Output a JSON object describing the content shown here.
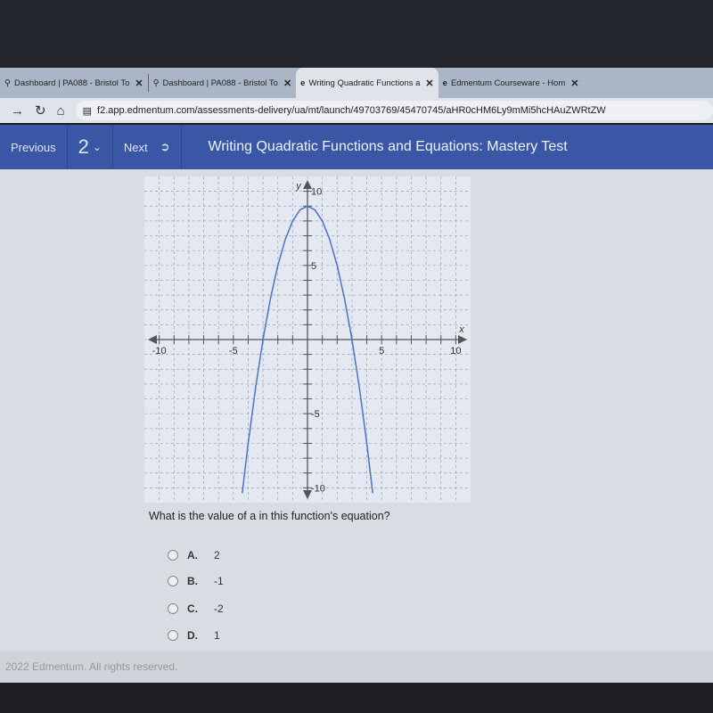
{
  "browser": {
    "tabs": [
      {
        "label": "Dashboard | PA088 - Bristol To",
        "icon": "location-pin-icon",
        "active": false
      },
      {
        "label": "Dashboard | PA088 - Bristol To",
        "icon": "location-pin-icon",
        "active": false
      },
      {
        "label": "Writing Quadratic Functions a",
        "icon": "edmentum-icon",
        "active": true
      },
      {
        "label": "Edmentum Courseware - Hom",
        "icon": "edmentum-icon",
        "active": false
      }
    ],
    "close_glyph": "✕",
    "url": "f2.app.edmentum.com/assessments-delivery/ua/mt/launch/49703769/45470745/aHR0cHM6Ly9mMi5hcHAuZWRtZW"
  },
  "nav": {
    "previous": "Previous",
    "question_number": "2",
    "next": "Next",
    "title": "Writing Quadratic Functions and Equations: Mastery Test"
  },
  "chart_data": {
    "type": "line",
    "xlabel": "x",
    "ylabel": "y",
    "xlim": [
      -10,
      10
    ],
    "ylim": [
      -10,
      10
    ],
    "grid": true,
    "x_tick_labels": [
      "-10",
      "-5",
      "5",
      "10"
    ],
    "y_tick_labels": [
      "10",
      "5",
      "-5",
      "-10"
    ],
    "x": [
      -4.4,
      -4,
      -3.5,
      -3,
      -2.5,
      -2,
      -1.5,
      -1,
      -0.5,
      0,
      0.5,
      1,
      1.5,
      2,
      2.5,
      3,
      3.5,
      4,
      4.4
    ],
    "y": [
      -10.36,
      -7,
      -3.25,
      0,
      2.75,
      5,
      6.75,
      8,
      8.75,
      9,
      8.75,
      8,
      6.75,
      5,
      2.75,
      0,
      -3.25,
      -7,
      -10.36
    ],
    "color": "#4a73c9"
  },
  "question": {
    "text": "What is the value of a in this function's equation?",
    "options": [
      {
        "letter": "A.",
        "value": "2"
      },
      {
        "letter": "B.",
        "value": "-1"
      },
      {
        "letter": "C.",
        "value": "-2"
      },
      {
        "letter": "D.",
        "value": "1"
      }
    ]
  },
  "footer": "2022 Edmentum. All rights reserved."
}
